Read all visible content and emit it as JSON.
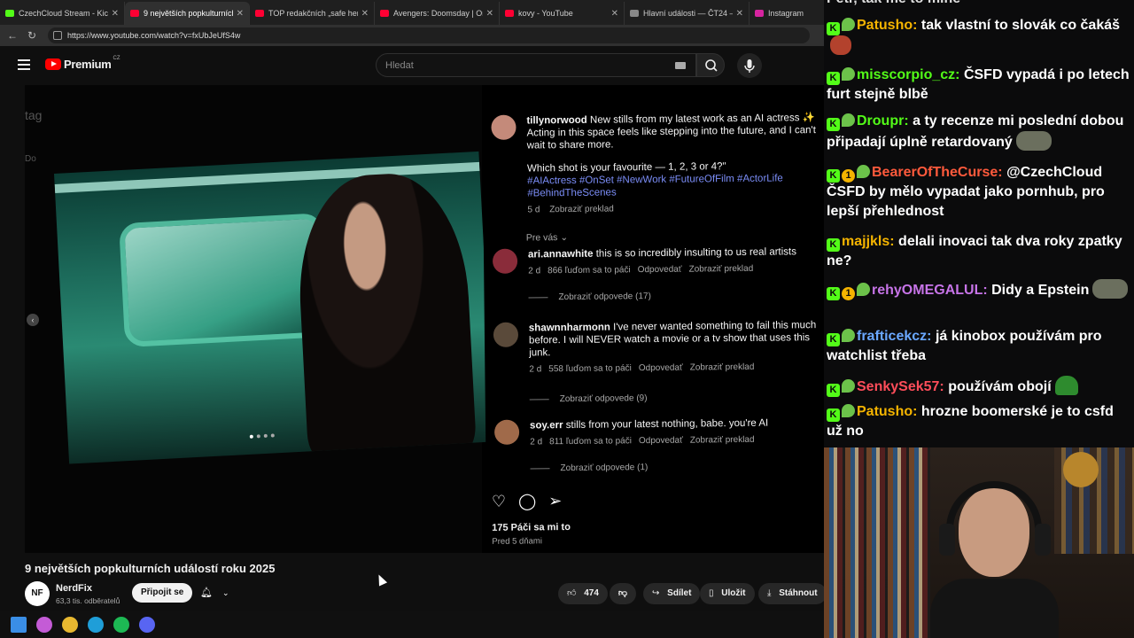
{
  "browser": {
    "tabs": [
      {
        "title": "CzechCloud Stream - Kick Da",
        "color": "#53fc18",
        "active": false
      },
      {
        "title": "9 největších popkulturních",
        "color": "#ff0033",
        "active": true
      },
      {
        "title": "TOP redakčních „safe her\", ke",
        "color": "#ff0033",
        "active": false
      },
      {
        "title": "Avengers: Doomsday | Only in",
        "color": "#ff0033",
        "active": false
      },
      {
        "title": "kovy - YouTube",
        "color": "#ff0033",
        "active": false
      },
      {
        "title": "Hlavní události — ČT24 — Č",
        "color": "#888888",
        "active": false
      },
      {
        "title": "Instagram",
        "color": "#d6249f",
        "active": false
      }
    ],
    "url": "https://www.youtube.com/watch?v=fxUbJeUfS4w"
  },
  "youtube": {
    "logo_text": "Premium",
    "logo_region": "CZ",
    "search_placeholder": "Hledat"
  },
  "instagram": {
    "ghost_text_1": "tag",
    "ghost_text_2": "Do",
    "caption": {
      "user": "tillynorwood",
      "text": "New stills from my latest work as an AI actress ✨ Acting in this space feels like stepping into the future, and I can't wait to share more.",
      "question": "Which shot is your favourite — 1, 2, 3 or 4?\"",
      "tags": "#AIActress #OnSet #NewWork #FutureOfFilm #ActorLife #BehindTheScenes",
      "age": "5 d",
      "translate": "Zobraziť preklad"
    },
    "for_you": "Pre vás ⌄",
    "comments": [
      {
        "user": "ari.annawhite",
        "text": "this is so incredibly insulting to us real artists",
        "age": "2 d",
        "likes": "866 ľuďom sa to páči",
        "reply": "Odpovedať",
        "translate": "Zobraziť preklad",
        "replies": "Zobraziť odpovede (17)",
        "avatar_color": "#8a2c3a"
      },
      {
        "user": "shawnnharmonn",
        "text": "I've never wanted something to fail this much before. I will NEVER watch a movie or a tv show that uses this junk.",
        "age": "2 d",
        "likes": "558 ľuďom sa to páči",
        "reply": "Odpovedať",
        "translate": "Zobraziť preklad",
        "replies": "Zobraziť odpovede (9)",
        "avatar_color": "#5a4a3a"
      },
      {
        "user": "soy.err",
        "text": "stills from your latest nothing, babe. you're AI",
        "age": "2 d",
        "likes": "811 ľuďom sa to páči",
        "reply": "Odpovedať",
        "translate": "Zobraziť preklad",
        "replies": "Zobraziť odpovede (1)",
        "avatar_color": "#a06a4a"
      }
    ],
    "like_count": "175 Páči sa mi to",
    "posted": "Pred 5 dňami"
  },
  "video": {
    "title": "9 největších popkulturních událostí roku 2025",
    "channel": "NerdFix",
    "channel_avatar": "NF",
    "subscribers": "63,3 tis. odběratelů",
    "join_label": "Připojit se",
    "like_count": "474",
    "share_label": "Sdílet",
    "save_label": "Uložit",
    "download_label": "Stáhnout"
  },
  "chat": [
    {
      "user": "Patusho",
      "color": "#f5b400",
      "text": "tak vlastní to slovák co čakáš",
      "badges": [
        "k",
        "clover"
      ],
      "emote": "red"
    },
    {
      "user": "misscorpio_cz",
      "color": "#53fc18",
      "text": "ČSFD vypadá i po letech furt stejně blbě",
      "badges": [
        "k",
        "clover"
      ],
      "emote": ""
    },
    {
      "user": "Droupr",
      "color": "#53fc18",
      "text": "a ty recenze mi poslední dobou připadají úplně retardovaný",
      "badges": [
        "k",
        "clover"
      ],
      "emote": "gray"
    },
    {
      "user": "BearerOfTheCurse",
      "color": "#ff5a3c",
      "text": "@CzechCloud ČSFD by mělo vypadat jako pornhub, pro lepší přehlednost",
      "badges": [
        "k",
        "sub",
        "clover"
      ],
      "emote": ""
    },
    {
      "user": "majjkls",
      "color": "#f5b400",
      "text": "delali inovaci tak dva roky zpatky ne?",
      "badges": [
        "k"
      ],
      "emote": ""
    },
    {
      "user": "rehyOMEGALUL",
      "color": "#c774e8",
      "text": "Didy a Epstein",
      "badges": [
        "k",
        "sub",
        "clover"
      ],
      "emote": "gray"
    },
    {
      "user": "frafticekcz",
      "color": "#6aa8ff",
      "text": "já kinobox používám pro watchlist třeba",
      "badges": [
        "k",
        "clover"
      ],
      "emote": ""
    },
    {
      "user": "SenkySek57",
      "color": "#ff4d5a",
      "text": "používám obojí",
      "badges": [
        "k",
        "clover"
      ],
      "emote": "green"
    },
    {
      "user": "Patusho",
      "color": "#f5b400",
      "text": "hrozne boomerské je to csfd už no",
      "badges": [
        "k",
        "clover"
      ],
      "emote": ""
    }
  ],
  "chat_partial_top": "Petr, tak me to mine",
  "taskbar": {
    "apps": [
      {
        "name": "windows-start",
        "color": "#3a8ee6"
      },
      {
        "name": "copilot",
        "color": "#c45bd6"
      },
      {
        "name": "file-explorer",
        "color": "#e8b830"
      },
      {
        "name": "edge",
        "color": "#1f9ed8"
      },
      {
        "name": "spotify",
        "color": "#1db954"
      },
      {
        "name": "discord",
        "color": "#5865f2"
      }
    ]
  }
}
